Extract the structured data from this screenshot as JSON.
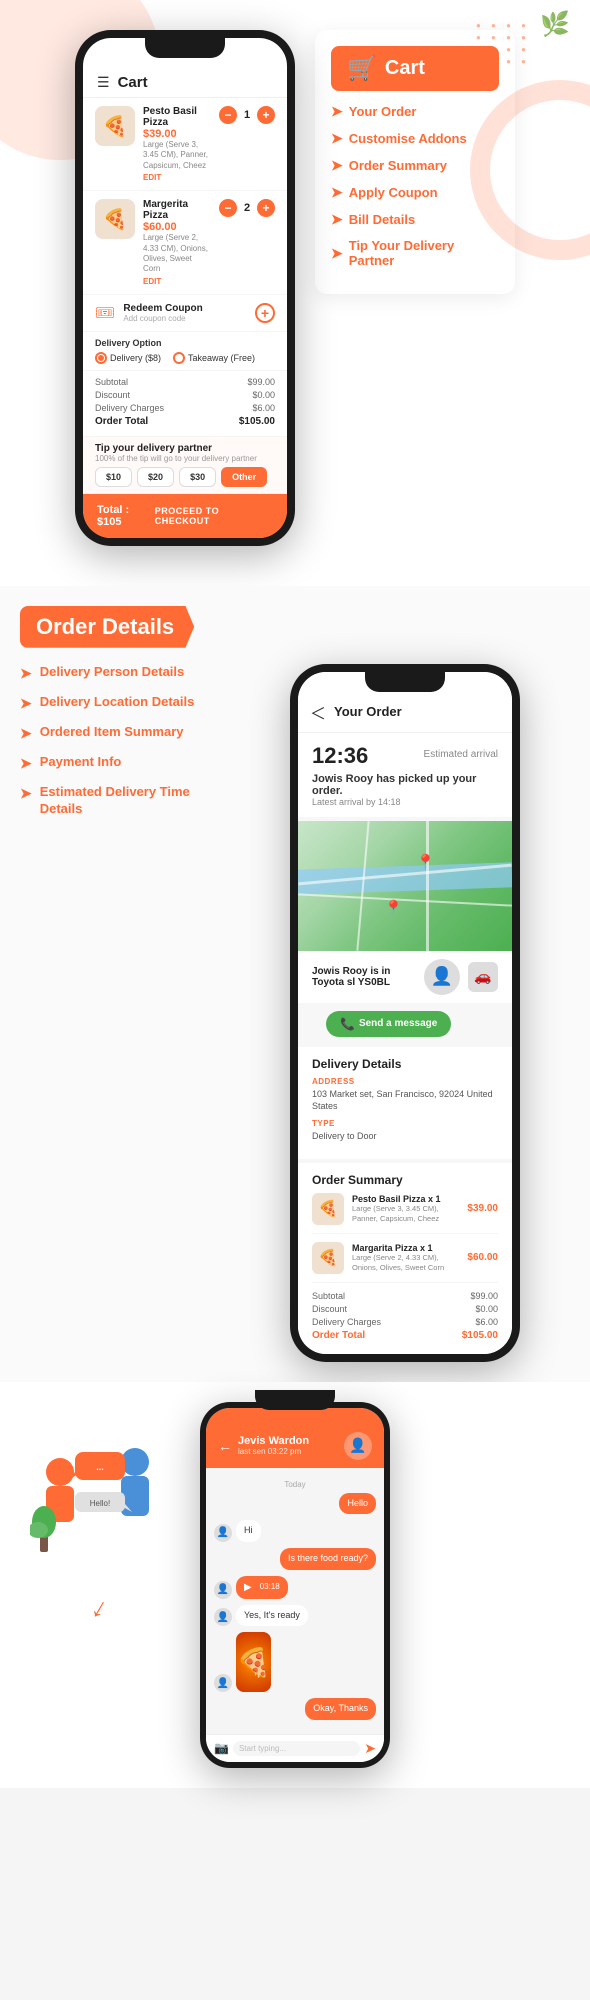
{
  "top": {
    "cart_title": "Cart",
    "items": [
      {
        "name": "Pesto Basil Pizza",
        "price": "$39.00",
        "desc": "Large (Serve 3, 3.45 CM), Panner, Capsicum, Cheez",
        "qty": "1",
        "edit": "EDIT",
        "emoji": "🍕"
      },
      {
        "name": "Margerita Pizza",
        "price": "$60.00",
        "desc": "Large (Serve 2, 4.33 CM), Onions, Olives, Sweet Corn",
        "qty": "2",
        "edit": "EDIT",
        "emoji": "🍕"
      }
    ],
    "coupon": {
      "title": "Redeem Coupon",
      "sub": "Add coupon code"
    },
    "delivery": {
      "label": "Delivery Option",
      "option1": "Delivery ($8)",
      "option2": "Takeaway (Free)"
    },
    "bill": {
      "subtotal_label": "Subtotal",
      "subtotal_value": "$99.00",
      "discount_label": "Discount",
      "discount_value": "$0.00",
      "charges_label": "Delivery Charges",
      "charges_value": "$6.00",
      "total_label": "Order Total",
      "total_value": "$105.00"
    },
    "tip": {
      "title": "Tip your delivery partner",
      "sub": "100% of the tip will go to your delivery partner",
      "amounts": [
        "$10",
        "$20",
        "$30",
        "Other"
      ]
    },
    "footer": {
      "total": "Total : $105",
      "checkout": "PROCEED TO CHECKOUT"
    }
  },
  "cart_info": {
    "title": "Cart",
    "items": [
      "Your Order",
      "Customise Addons",
      "Order Summary",
      "Apply Coupon",
      "Bill Details",
      "Tip Your Delivery Partner"
    ]
  },
  "middle": {
    "banner": "Order Details",
    "items": [
      "Delivery Person Details",
      "Delivery Location Details",
      "Ordered Item Summary",
      "Payment Info",
      "Estimated Delivery Time Details"
    ]
  },
  "order_detail": {
    "back_label": "Your Order",
    "time": "12:36",
    "est_label": "Estimated arrival",
    "status": "has picked up your order.",
    "driver_name": "Jowis Rooy",
    "latest": "Latest arrival by 14:18",
    "car_info": "Jowis Rooy is in Toyota sl YS0BL",
    "msg_btn": "Send a message",
    "delivery_details": {
      "heading": "Delivery Details",
      "address_label": "ADDRESS",
      "address_value": "103 Market set, San Francisco, 92024 United States",
      "type_label": "TYPE",
      "type_value": "Delivery to Door"
    },
    "order_summary": {
      "heading": "Order Summary",
      "items": [
        {
          "name": "Pesto Basil Pizza x 1",
          "desc": "Large (Serve 3, 3.45 CM), Panner, Capsicum, Cheez",
          "price": "$39.00",
          "emoji": "🍕"
        },
        {
          "name": "Margarita Pizza x 1",
          "desc": "Large (Serve 2, 4.33 CM), Onions, Olives, Sweet Corn",
          "price": "$60.00",
          "emoji": "🍕"
        }
      ],
      "subtotal_label": "Subtotal",
      "subtotal_value": "$99.00",
      "discount_label": "Discount",
      "discount_value": "$0.00",
      "charges_label": "Delivery Charges",
      "charges_value": "$6.00",
      "total_label": "Order Total",
      "total_value": "$105.00"
    }
  },
  "chat": {
    "name": "Jevis Wardon",
    "time": "last sen 03:22 pm",
    "date": "Today",
    "messages": [
      {
        "type": "sent",
        "text": "Hello"
      },
      {
        "type": "received",
        "text": "Hi"
      },
      {
        "type": "sent",
        "text": "Is there food ready?"
      },
      {
        "type": "received",
        "audio": "03:18"
      },
      {
        "type": "received",
        "text": "Yes, It's ready"
      },
      {
        "type": "sent",
        "text": "Okay, Thanks"
      }
    ],
    "input_placeholder": "Start typing...",
    "footer_note": "Okay, Thanks"
  },
  "colors": {
    "primary": "#FF6B35",
    "green": "#4caf50",
    "dark": "#1a1a1a",
    "text": "#222222",
    "muted": "#888888"
  }
}
